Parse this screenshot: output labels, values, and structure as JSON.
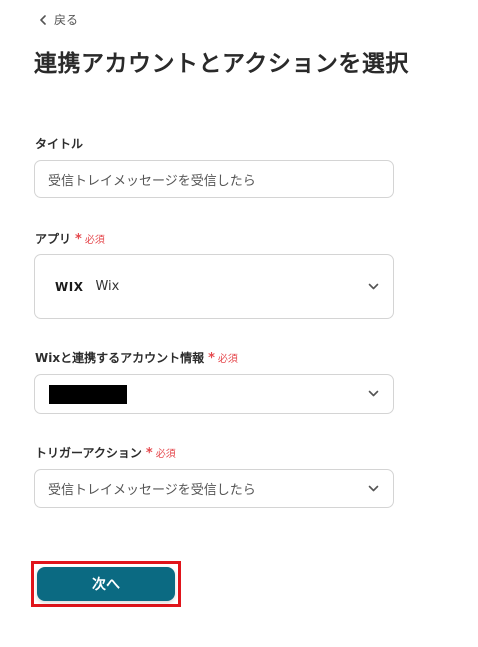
{
  "nav": {
    "back_label": "戻る"
  },
  "page": {
    "title": "連携アカウントとアクションを選択"
  },
  "required_label": "必須",
  "fields": {
    "title": {
      "label": "タイトル",
      "value": "受信トレイメッセージを受信したら"
    },
    "app": {
      "label": "アプリ",
      "logo_text": "WIX",
      "value": "Wix"
    },
    "account": {
      "label": "Wixと連携するアカウント情報"
    },
    "trigger": {
      "label": "トリガーアクション",
      "value": "受信トレイメッセージを受信したら"
    }
  },
  "buttons": {
    "next_label": "次へ"
  },
  "colors": {
    "primary": "#0b6a82",
    "required": "#e5484d",
    "highlight_border": "#e0141b"
  }
}
